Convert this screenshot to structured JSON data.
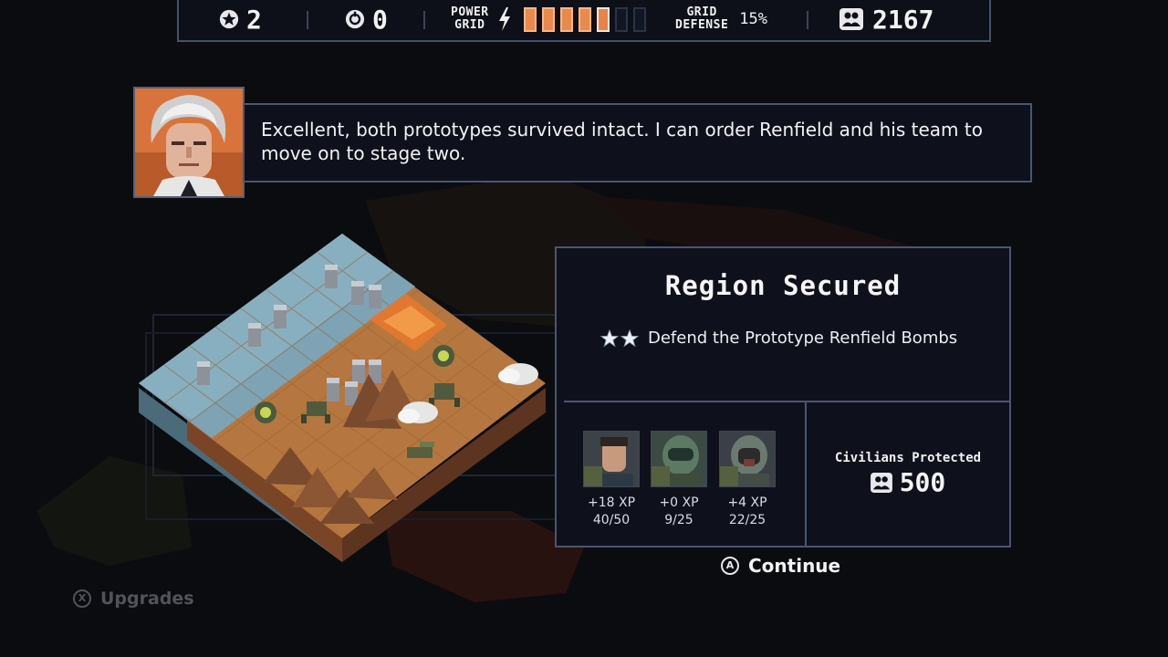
{
  "topbar": {
    "stars": "2",
    "reputation": "0",
    "power_grid_label_1": "POWER",
    "power_grid_label_2": "GRID",
    "power_grid_filled": 5,
    "power_grid_total": 7,
    "grid_defense_label_1": "GRID",
    "grid_defense_label_2": "DEFENSE",
    "grid_defense_value": "15%",
    "population": "2167"
  },
  "dialog": {
    "text": "Excellent, both prototypes survived intact. I can order Renfield and his team to move on to stage two."
  },
  "results": {
    "title": "Region Secured",
    "objective_stars": 2,
    "objective": "Defend the Prototype Renfield Bombs",
    "pilots": [
      {
        "xp_gain": "+18 XP",
        "xp_progress": "40/50"
      },
      {
        "xp_gain": "+0 XP",
        "xp_progress": "9/25"
      },
      {
        "xp_gain": "+4 XP",
        "xp_progress": "22/25"
      }
    ],
    "civilians_label": "Civilians Protected",
    "civilians_value": "500"
  },
  "buttons": {
    "continue_glyph": "A",
    "continue": "Continue",
    "upgrades_glyph": "X",
    "upgrades": "Upgrades"
  },
  "colors": {
    "background": "#0b0c10",
    "panel": "#0e111b",
    "panel_border": "#4b5570",
    "power_bar": "#e88a4c",
    "sand": "#b5773f",
    "water": "#7da3b5"
  },
  "icons": {
    "stars": "star-icon",
    "reputation": "reputation-icon",
    "power": "lightning-icon",
    "population": "population-icon",
    "objective": "star-icon"
  }
}
